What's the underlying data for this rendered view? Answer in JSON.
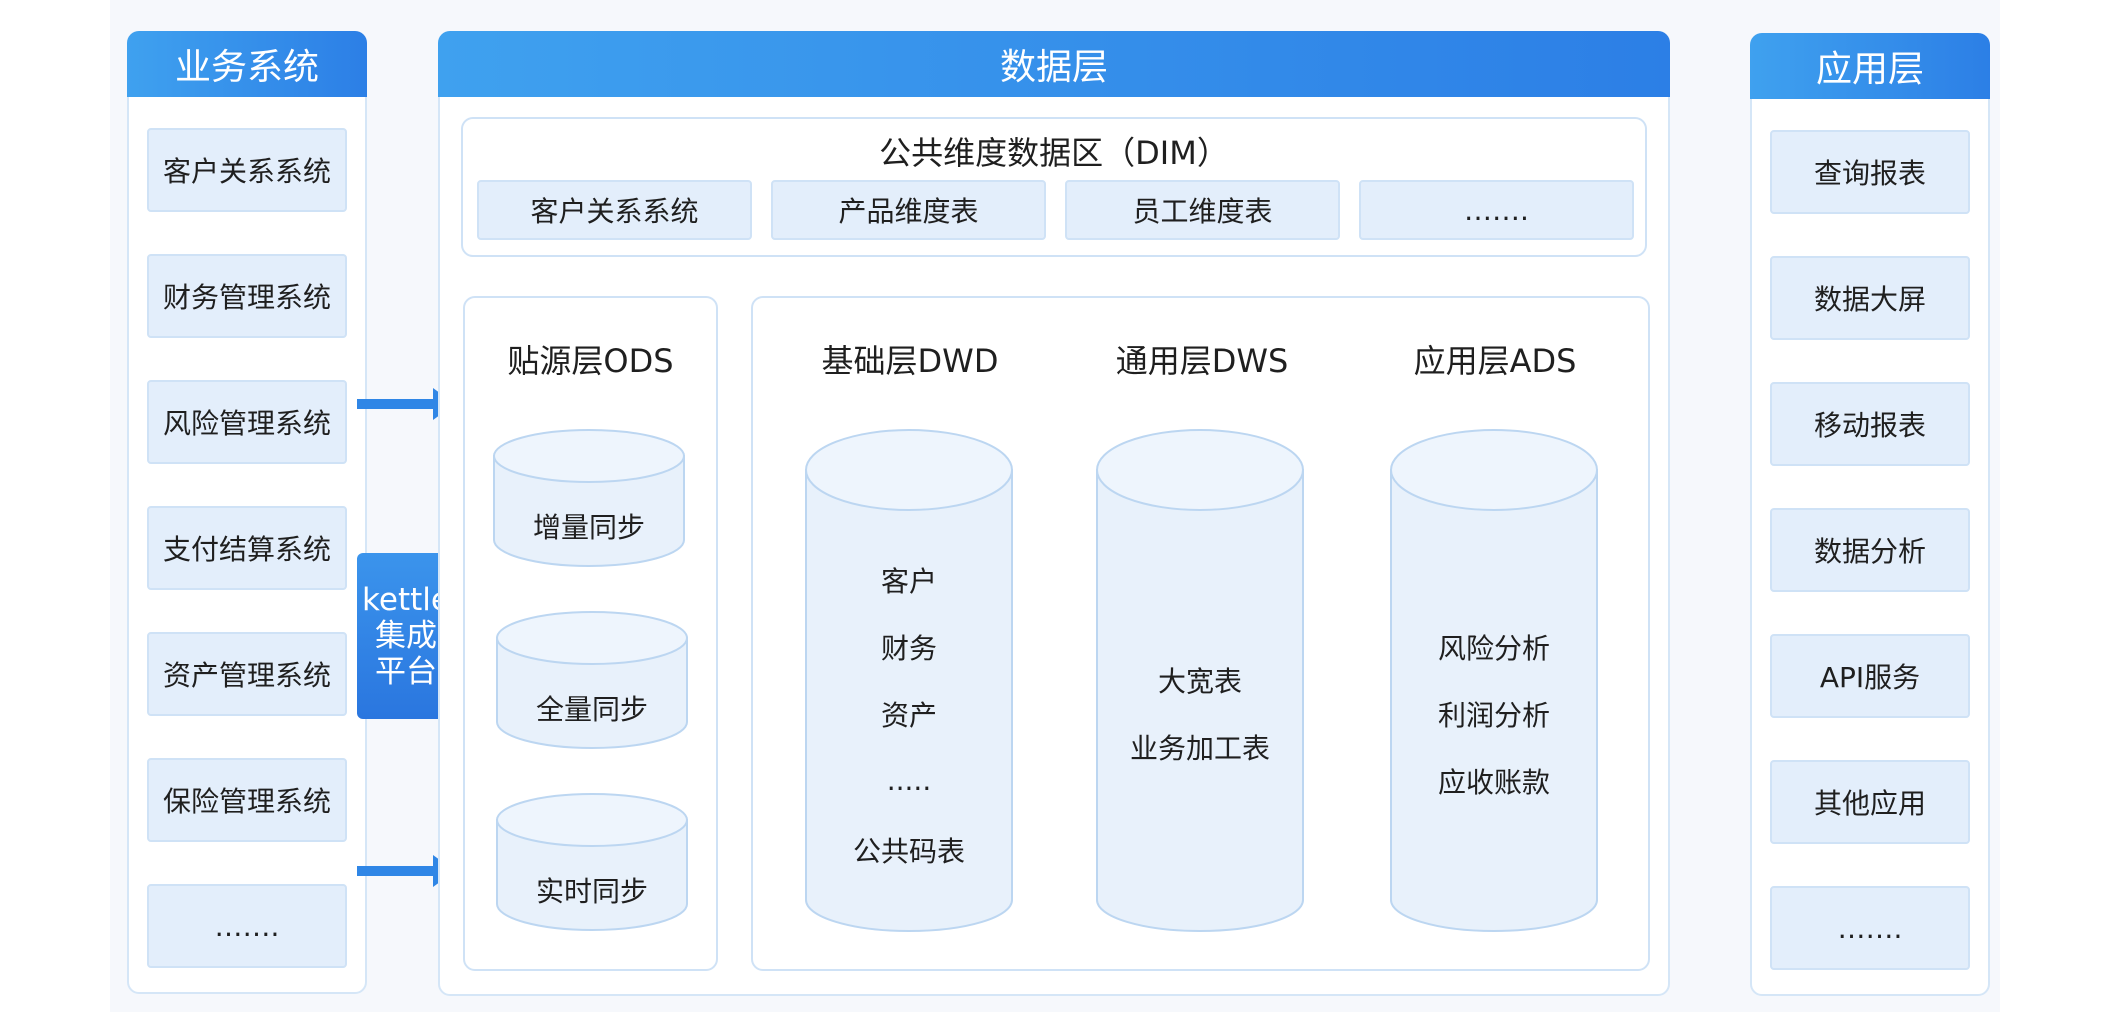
{
  "left": {
    "title": "业务系统",
    "items": [
      "客户关系系统",
      "财务管理系统",
      "风险管理系统",
      "支付结算系统",
      "资产管理系统",
      "保险管理系统",
      "……."
    ]
  },
  "middle": {
    "title": "数据层",
    "dim": {
      "title": "公共维度数据区（DIM）",
      "items": [
        "客户关系系统",
        "产品维度表",
        "员工维度表",
        "……."
      ]
    },
    "ods": {
      "title": "贴源层ODS",
      "items": [
        "增量同步",
        "全量同步",
        "实时同步"
      ]
    },
    "dwd": {
      "title": "基础层DWD",
      "items": [
        "客户",
        "财务",
        "资产",
        ".....",
        "公共码表"
      ]
    },
    "dws": {
      "title": "通用层DWS",
      "items": [
        "大宽表",
        "业务加工表"
      ]
    },
    "ads": {
      "title": "应用层ADS",
      "items": [
        "风险分析",
        "利润分析",
        "应收账款"
      ]
    }
  },
  "kettle": {
    "lines": [
      "kettle",
      "集成",
      "平台"
    ]
  },
  "right": {
    "title": "应用层",
    "items": [
      "查询报表",
      "数据大屏",
      "移动报表",
      "数据分析",
      "API服务",
      "其他应用",
      "……."
    ]
  },
  "colors": {
    "header_gradient_start": "#3fa1ef",
    "header_gradient_end": "#2c7fe6",
    "card_fill": "#e3eefb",
    "cylinder_fill": "#e8f1fb",
    "cylinder_stroke": "#bcd6f1",
    "arrow": "#2f86e6"
  }
}
